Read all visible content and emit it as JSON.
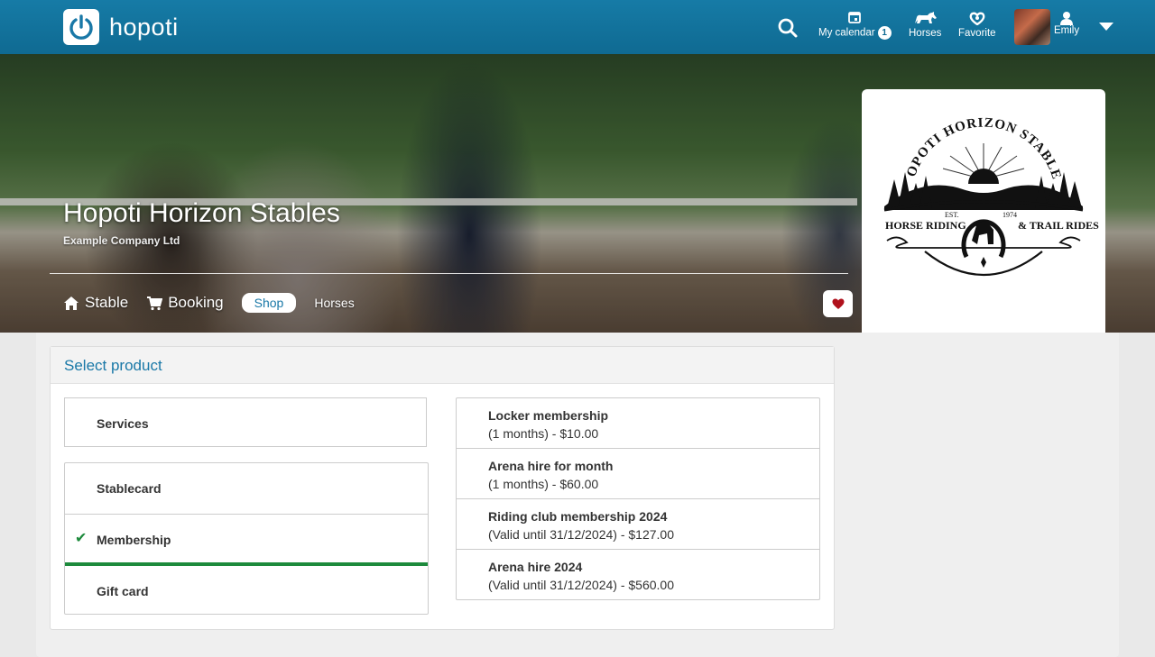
{
  "app": {
    "name": "hopoti"
  },
  "header": {
    "calendar_label": "My calendar",
    "calendar_badge": "1",
    "horses_label": "Horses",
    "favorite_label": "Favorite",
    "user_name": "Emily"
  },
  "stable": {
    "name": "Hopoti Horizon Stables",
    "company": "Example Company Ltd",
    "logo": {
      "arc_text": "HOPOTI HORIZON STABLES",
      "est": "EST.",
      "year": "1974",
      "left_text": "HORSE RIDING",
      "right_text": "& TRAIL RIDES"
    }
  },
  "tabs": {
    "stable": "Stable",
    "booking": "Booking",
    "shop": "Shop",
    "horses": "Horses"
  },
  "shop": {
    "header": "Select product",
    "categories": {
      "services": "Services",
      "stablecard": "Stablecard",
      "membership": "Membership",
      "giftcard": "Gift card"
    },
    "selected_category": "Membership",
    "products": [
      {
        "name": "Locker membership",
        "detail": "(1 months) - $10.00"
      },
      {
        "name": "Arena hire for month",
        "detail": "(1 months) - $60.00"
      },
      {
        "name": "Riding club membership 2024",
        "detail": "(Valid until 31/12/2024) - $127.00"
      },
      {
        "name": "Arena hire 2024",
        "detail": "(Valid until 31/12/2024) - $560.00"
      }
    ]
  },
  "colors": {
    "topbar": "#0f6a92",
    "accent": "#1978a7",
    "selected": "#1d8a3c",
    "heart": "#b0111c"
  }
}
